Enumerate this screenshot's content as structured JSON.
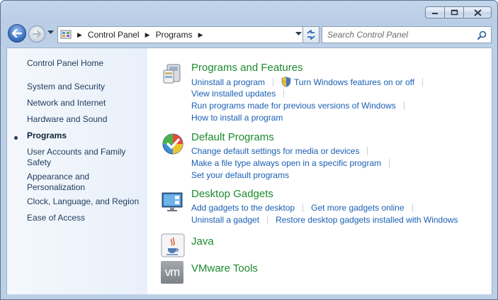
{
  "window": {
    "minimize": "minimize",
    "maximize": "maximize",
    "close": "close"
  },
  "address": {
    "crumbs": [
      "Control Panel",
      "Programs"
    ]
  },
  "search": {
    "placeholder": "Search Control Panel"
  },
  "sidebar": {
    "items": [
      "Control Panel Home",
      "System and Security",
      "Network and Internet",
      "Hardware and Sound",
      "Programs",
      "User Accounts and Family Safety",
      "Appearance and Personalization",
      "Clock, Language, and Region",
      "Ease of Access"
    ],
    "active_index": 4
  },
  "categories": {
    "programs_features": {
      "title": "Programs and Features",
      "links": [
        "Uninstall a program",
        "Turn Windows features on or off",
        "View installed updates",
        "Run programs made for previous versions of Windows",
        "How to install a program"
      ]
    },
    "default_programs": {
      "title": "Default Programs",
      "links": [
        "Change default settings for media or devices",
        "Make a file type always open in a specific program",
        "Set your default programs"
      ]
    },
    "desktop_gadgets": {
      "title": "Desktop Gadgets",
      "links": [
        "Add gadgets to the desktop",
        "Get more gadgets online",
        "Uninstall a gadget",
        "Restore desktop gadgets installed with Windows"
      ]
    },
    "java": {
      "title": "Java"
    },
    "vmware": {
      "title": "VMware Tools",
      "icon_text": "vm"
    }
  },
  "colors": {
    "category_title": "#1d8a2e",
    "link": "#1a5fb4"
  }
}
